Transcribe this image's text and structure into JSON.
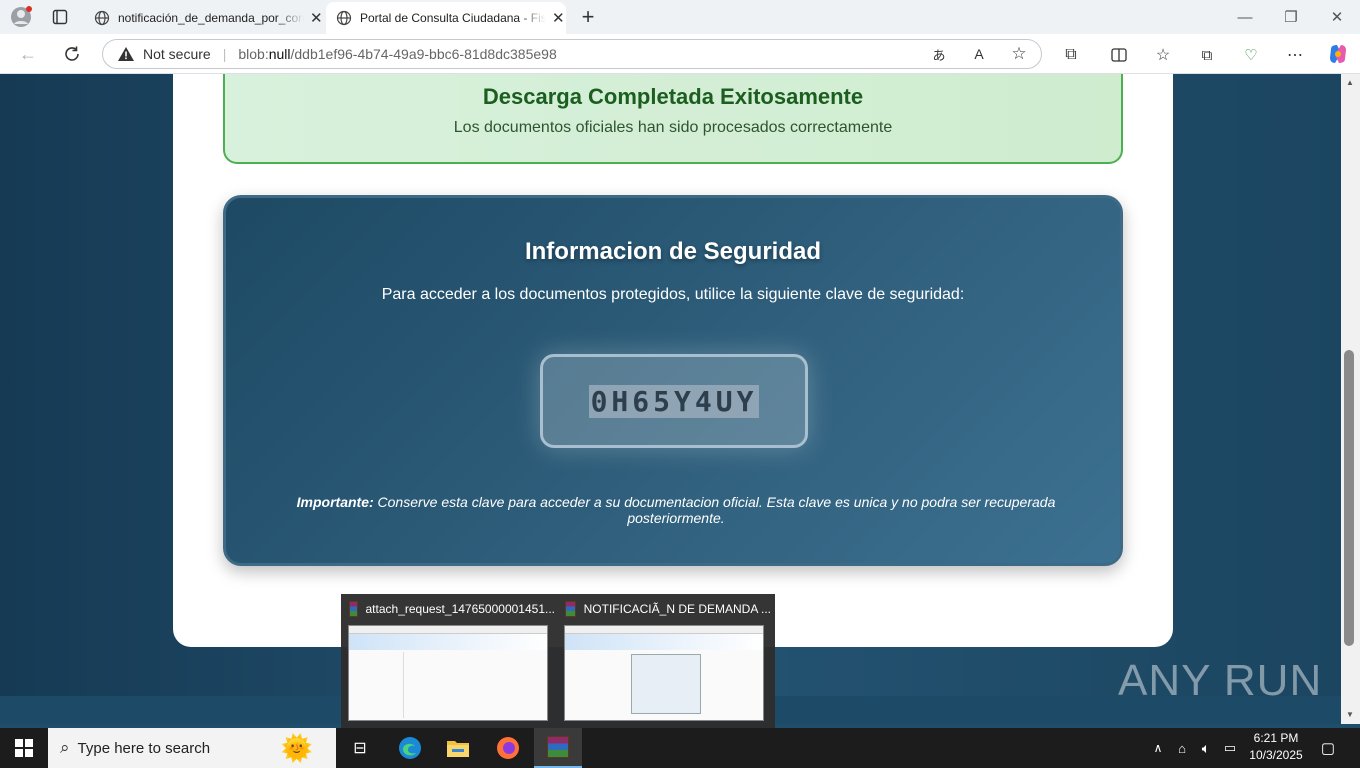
{
  "browser": {
    "tabs": [
      {
        "label": "notificación_de_demanda_por_correo",
        "active": false
      },
      {
        "label": "Portal de Consulta Ciudadana - Fiscalía",
        "active": true
      }
    ],
    "security_label": "Not secure",
    "url_prefix": "blob:",
    "url_host": "null",
    "url_path": "/ddb1ef96-4b74-49a9-bbc6-81d8dc385e98"
  },
  "page": {
    "success_title": "Descarga Completada Exitosamente",
    "success_subtitle": "Los documentos oficiales han sido procesados correctamente",
    "security_title": "Informacion de Seguridad",
    "security_lead": "Para acceder a los documentos protegidos, utilice la siguiente clave de seguridad:",
    "security_key": "0H65Y4UY",
    "note_label": "Importante:",
    "note_text": " Conserve esta clave para acceder a su documentacion oficial. Esta clave es unica y no podra ser recuperada posteriormente."
  },
  "preview": {
    "windows": [
      {
        "title": "attach_request_14765000001451..."
      },
      {
        "title": "NOTIFICACIÃ_N DE DEMANDA ..."
      }
    ]
  },
  "taskbar": {
    "search_placeholder": "Type here to search",
    "time": "6:21 PM",
    "date": "10/3/2025"
  },
  "watermark": "ANY RUN",
  "colors": {
    "success_green": "#1b5e20",
    "security_panel": "#2f5f7c",
    "page_bg": "#1f4e6b"
  }
}
